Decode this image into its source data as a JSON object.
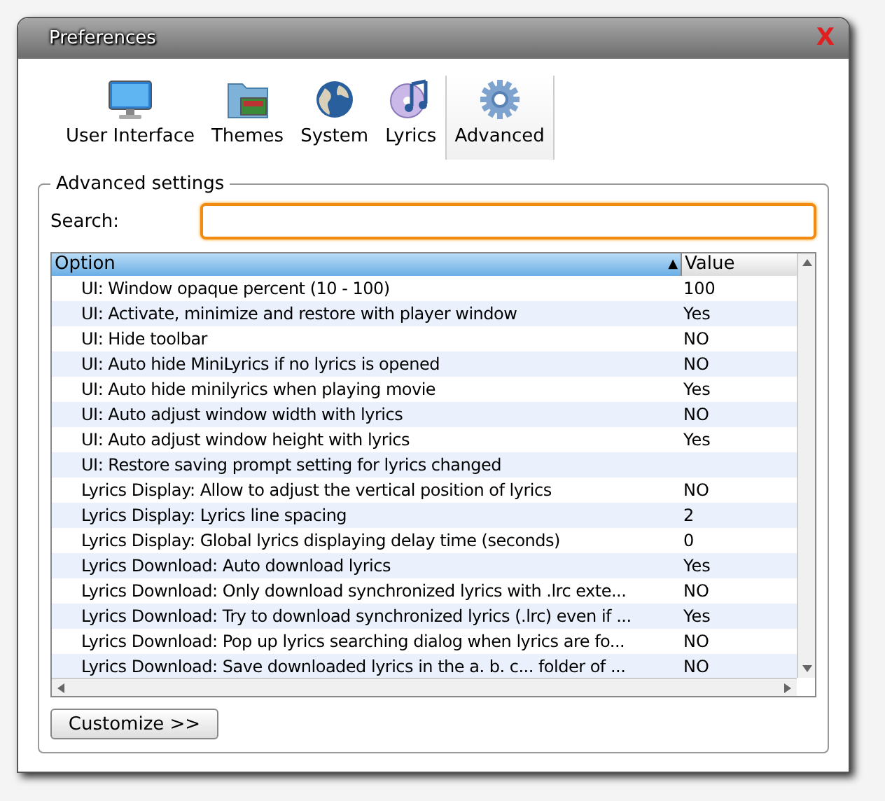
{
  "window": {
    "title": "Preferences",
    "close": "X"
  },
  "tabs": [
    {
      "label": "User Interface",
      "selected": false
    },
    {
      "label": "Themes",
      "selected": false
    },
    {
      "label": "System",
      "selected": false
    },
    {
      "label": "Lyrics",
      "selected": false
    },
    {
      "label": "Advanced",
      "selected": true
    }
  ],
  "group": {
    "title": "Advanced settings",
    "search_label": "Search:"
  },
  "table": {
    "columns": [
      "Option",
      "Value"
    ],
    "sort_mark": "▲",
    "rows": [
      {
        "option": "UI: Window opaque percent (10 - 100)",
        "value": "100"
      },
      {
        "option": "UI: Activate, minimize and restore with player window",
        "value": "Yes"
      },
      {
        "option": "UI: Hide toolbar",
        "value": "NO"
      },
      {
        "option": "UI: Auto hide MiniLyrics if no lyrics is opened",
        "value": "NO"
      },
      {
        "option": "UI: Auto hide minilyrics when playing movie",
        "value": "Yes"
      },
      {
        "option": "UI: Auto adjust window width with lyrics",
        "value": "NO"
      },
      {
        "option": "UI: Auto adjust window height with lyrics",
        "value": "Yes"
      },
      {
        "option": "UI: Restore saving prompt setting for lyrics changed"
      },
      {
        "option": "Lyrics Display: Allow to adjust the vertical position of lyrics",
        "value": "NO"
      },
      {
        "option": "Lyrics Display: Lyrics line spacing",
        "value": "2"
      },
      {
        "option": "Lyrics Display: Global lyrics displaying delay time (seconds)",
        "value": "0"
      },
      {
        "option": "Lyrics Download: Auto download lyrics",
        "value": "Yes"
      },
      {
        "option": "Lyrics Download: Only download synchronized lyrics with .lrc exte...",
        "value": "NO"
      },
      {
        "option": "Lyrics Download: Try to download synchronized lyrics (.lrc) even if ...",
        "value": "Yes"
      },
      {
        "option": "Lyrics Download: Pop up lyrics searching dialog when lyrics are fo...",
        "value": "NO"
      },
      {
        "option": "Lyrics Download: Save downloaded lyrics in the a. b. c... folder of ...",
        "value": "NO"
      }
    ]
  },
  "buttons": [
    "Customize >>"
  ]
}
